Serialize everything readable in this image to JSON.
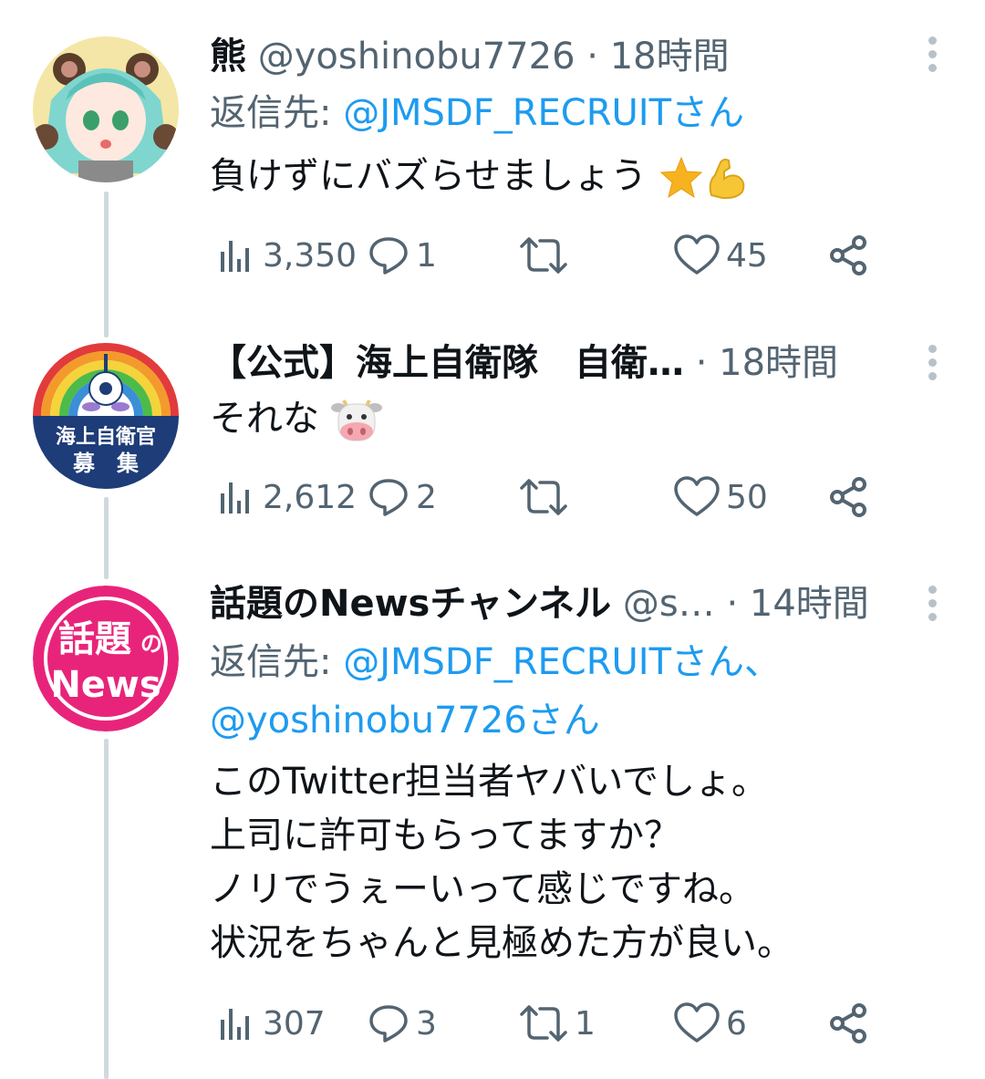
{
  "tweets": [
    {
      "name": "熊",
      "handle": "@yoshinobu7726",
      "separator": "·",
      "time": "18時間",
      "reply_prefix": "返信先: ",
      "reply_to_1": "@JMSDF_RECRUITさん",
      "reply_to_2": "",
      "text": "負けずにバズらせましょう",
      "emoji": [
        "star-emoji",
        "flexed-biceps-emoji"
      ],
      "views": "3,350",
      "replies": "1",
      "retweets": "",
      "likes": "45"
    },
    {
      "name": "【公式】海上自衛隊　自衛…",
      "handle": "",
      "separator": "·",
      "time": "18時間",
      "text": "それな",
      "emoji": [
        "cow-face-emoji"
      ],
      "views": "2,612",
      "replies": "2",
      "retweets": "",
      "likes": "50",
      "avatar_text_1": "海上自衛官",
      "avatar_text_2": "募　集"
    },
    {
      "name": "話題のNewsチャンネル",
      "handle": "@s…",
      "separator": "·",
      "time": "14時間",
      "reply_prefix": "返信先: ",
      "reply_to_1": "@JMSDF_RECRUITさん、",
      "reply_to_2": "@yoshinobu7726さん",
      "text_lines": [
        "このTwitter担当者ヤバいでしょ。",
        "上司に許可もらってますか？",
        "ノリでうぇーいって感じですね。",
        "状況をちゃんと見極めた方が良い。"
      ],
      "views": "307",
      "replies": "3",
      "retweets": "1",
      "likes": "6",
      "avatar_text_1": "話題",
      "avatar_text_2": "の",
      "avatar_text_3": "News"
    }
  ],
  "colors": {
    "accent": "#1d9bf0",
    "secondary_text": "#536471",
    "thread_line": "#cfd9de",
    "news_avatar": "#e8247a"
  }
}
